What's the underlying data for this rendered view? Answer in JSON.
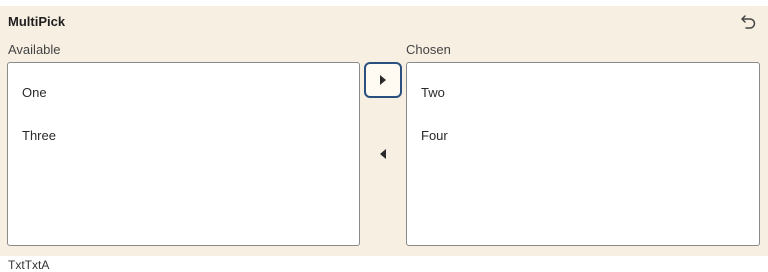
{
  "widget": {
    "title": "MultiPick",
    "reset_icon": "undo-icon"
  },
  "available": {
    "label": "Available",
    "items": [
      "One",
      "Three"
    ]
  },
  "chosen": {
    "label": "Chosen",
    "items": [
      "Two",
      "Four"
    ]
  },
  "controls": {
    "move_right_icon": "caret-right-icon",
    "move_left_icon": "caret-left-icon"
  },
  "footer": {
    "text": "TxtTxtA"
  },
  "colors": {
    "panel_bg": "#f7efe2",
    "focus_border": "#2b4f7e",
    "list_border": "#8a8a8a"
  }
}
